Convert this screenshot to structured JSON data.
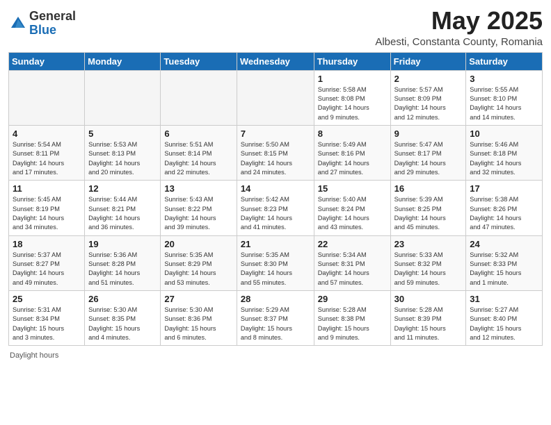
{
  "logo": {
    "general": "General",
    "blue": "Blue"
  },
  "title": "May 2025",
  "subtitle": "Albesti, Constanta County, Romania",
  "weekdays": [
    "Sunday",
    "Monday",
    "Tuesday",
    "Wednesday",
    "Thursday",
    "Friday",
    "Saturday"
  ],
  "weeks": [
    [
      {
        "day": "",
        "info": ""
      },
      {
        "day": "",
        "info": ""
      },
      {
        "day": "",
        "info": ""
      },
      {
        "day": "",
        "info": ""
      },
      {
        "day": "1",
        "info": "Sunrise: 5:58 AM\nSunset: 8:08 PM\nDaylight: 14 hours\nand 9 minutes."
      },
      {
        "day": "2",
        "info": "Sunrise: 5:57 AM\nSunset: 8:09 PM\nDaylight: 14 hours\nand 12 minutes."
      },
      {
        "day": "3",
        "info": "Sunrise: 5:55 AM\nSunset: 8:10 PM\nDaylight: 14 hours\nand 14 minutes."
      }
    ],
    [
      {
        "day": "4",
        "info": "Sunrise: 5:54 AM\nSunset: 8:11 PM\nDaylight: 14 hours\nand 17 minutes."
      },
      {
        "day": "5",
        "info": "Sunrise: 5:53 AM\nSunset: 8:13 PM\nDaylight: 14 hours\nand 20 minutes."
      },
      {
        "day": "6",
        "info": "Sunrise: 5:51 AM\nSunset: 8:14 PM\nDaylight: 14 hours\nand 22 minutes."
      },
      {
        "day": "7",
        "info": "Sunrise: 5:50 AM\nSunset: 8:15 PM\nDaylight: 14 hours\nand 24 minutes."
      },
      {
        "day": "8",
        "info": "Sunrise: 5:49 AM\nSunset: 8:16 PM\nDaylight: 14 hours\nand 27 minutes."
      },
      {
        "day": "9",
        "info": "Sunrise: 5:47 AM\nSunset: 8:17 PM\nDaylight: 14 hours\nand 29 minutes."
      },
      {
        "day": "10",
        "info": "Sunrise: 5:46 AM\nSunset: 8:18 PM\nDaylight: 14 hours\nand 32 minutes."
      }
    ],
    [
      {
        "day": "11",
        "info": "Sunrise: 5:45 AM\nSunset: 8:19 PM\nDaylight: 14 hours\nand 34 minutes."
      },
      {
        "day": "12",
        "info": "Sunrise: 5:44 AM\nSunset: 8:21 PM\nDaylight: 14 hours\nand 36 minutes."
      },
      {
        "day": "13",
        "info": "Sunrise: 5:43 AM\nSunset: 8:22 PM\nDaylight: 14 hours\nand 39 minutes."
      },
      {
        "day": "14",
        "info": "Sunrise: 5:42 AM\nSunset: 8:23 PM\nDaylight: 14 hours\nand 41 minutes."
      },
      {
        "day": "15",
        "info": "Sunrise: 5:40 AM\nSunset: 8:24 PM\nDaylight: 14 hours\nand 43 minutes."
      },
      {
        "day": "16",
        "info": "Sunrise: 5:39 AM\nSunset: 8:25 PM\nDaylight: 14 hours\nand 45 minutes."
      },
      {
        "day": "17",
        "info": "Sunrise: 5:38 AM\nSunset: 8:26 PM\nDaylight: 14 hours\nand 47 minutes."
      }
    ],
    [
      {
        "day": "18",
        "info": "Sunrise: 5:37 AM\nSunset: 8:27 PM\nDaylight: 14 hours\nand 49 minutes."
      },
      {
        "day": "19",
        "info": "Sunrise: 5:36 AM\nSunset: 8:28 PM\nDaylight: 14 hours\nand 51 minutes."
      },
      {
        "day": "20",
        "info": "Sunrise: 5:35 AM\nSunset: 8:29 PM\nDaylight: 14 hours\nand 53 minutes."
      },
      {
        "day": "21",
        "info": "Sunrise: 5:35 AM\nSunset: 8:30 PM\nDaylight: 14 hours\nand 55 minutes."
      },
      {
        "day": "22",
        "info": "Sunrise: 5:34 AM\nSunset: 8:31 PM\nDaylight: 14 hours\nand 57 minutes."
      },
      {
        "day": "23",
        "info": "Sunrise: 5:33 AM\nSunset: 8:32 PM\nDaylight: 14 hours\nand 59 minutes."
      },
      {
        "day": "24",
        "info": "Sunrise: 5:32 AM\nSunset: 8:33 PM\nDaylight: 15 hours\nand 1 minute."
      }
    ],
    [
      {
        "day": "25",
        "info": "Sunrise: 5:31 AM\nSunset: 8:34 PM\nDaylight: 15 hours\nand 3 minutes."
      },
      {
        "day": "26",
        "info": "Sunrise: 5:30 AM\nSunset: 8:35 PM\nDaylight: 15 hours\nand 4 minutes."
      },
      {
        "day": "27",
        "info": "Sunrise: 5:30 AM\nSunset: 8:36 PM\nDaylight: 15 hours\nand 6 minutes."
      },
      {
        "day": "28",
        "info": "Sunrise: 5:29 AM\nSunset: 8:37 PM\nDaylight: 15 hours\nand 8 minutes."
      },
      {
        "day": "29",
        "info": "Sunrise: 5:28 AM\nSunset: 8:38 PM\nDaylight: 15 hours\nand 9 minutes."
      },
      {
        "day": "30",
        "info": "Sunrise: 5:28 AM\nSunset: 8:39 PM\nDaylight: 15 hours\nand 11 minutes."
      },
      {
        "day": "31",
        "info": "Sunrise: 5:27 AM\nSunset: 8:40 PM\nDaylight: 15 hours\nand 12 minutes."
      }
    ]
  ],
  "footer": "Daylight hours"
}
